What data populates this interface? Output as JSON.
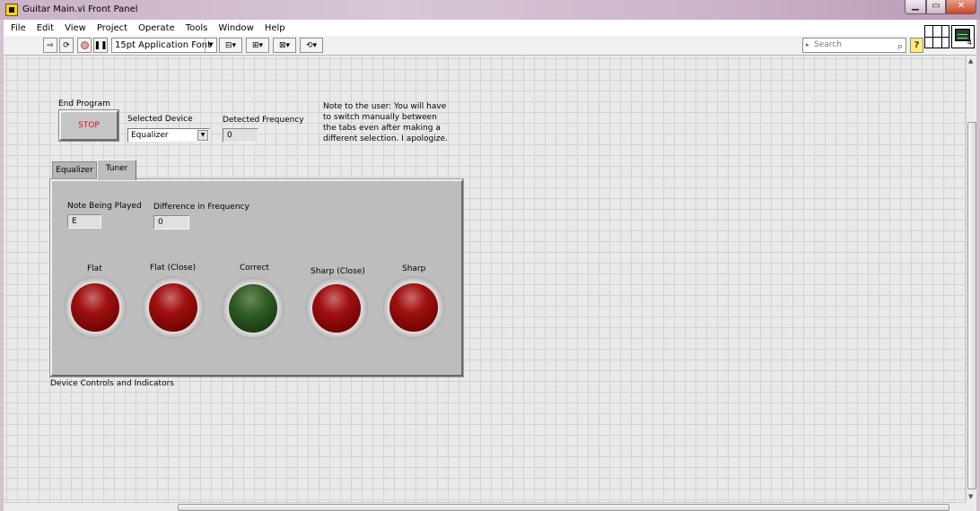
{
  "window": {
    "title": "Guitar Main.vi Front Panel"
  },
  "menu": [
    "File",
    "Edit",
    "View",
    "Project",
    "Operate",
    "Tools",
    "Window",
    "Help"
  ],
  "toolbar": {
    "font": "15pt Application Font",
    "search_caption": "▸",
    "search_placeholder": "Search",
    "help": "?",
    "vi_icon_number": "4"
  },
  "controls": {
    "end_program": {
      "label": "End Program",
      "button": "STOP"
    },
    "selected_device": {
      "label": "Selected Device",
      "value": "Equalizer"
    },
    "detected_frequency": {
      "label": "Detected Frequency",
      "value": "0"
    },
    "note": "Note to the user: You will have to switch manually between the tabs even after making a different selection.  I apologize."
  },
  "tabs": {
    "items": [
      {
        "label": "Equalizer",
        "active": false
      },
      {
        "label": "Tuner",
        "active": true
      }
    ],
    "caption": "Device Controls and Indicators"
  },
  "tuner": {
    "note_being_played": {
      "label": "Note Being Played",
      "value": "E"
    },
    "difference_in_frequency": {
      "label": "Difference in Frequency",
      "value": "0"
    },
    "leds": [
      {
        "label": "Flat",
        "state": "red"
      },
      {
        "label": "Flat (Close)",
        "state": "red"
      },
      {
        "label": "Correct",
        "state": "green"
      },
      {
        "label": "Sharp (Close)",
        "state": "red"
      },
      {
        "label": "Sharp",
        "state": "red"
      }
    ]
  },
  "colors": {
    "stop_text": "#e01010",
    "led_red": "#a01010",
    "led_green": "#2f5a22"
  }
}
